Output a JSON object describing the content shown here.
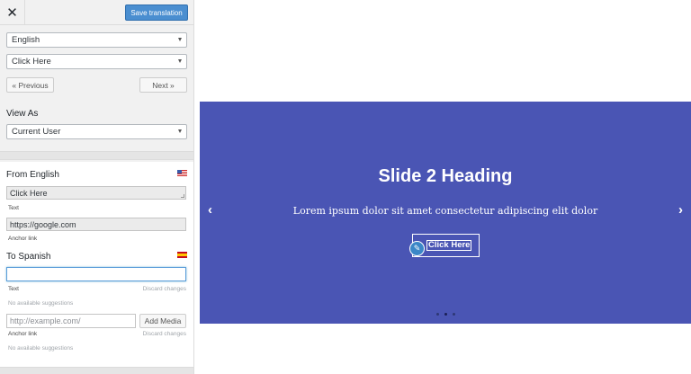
{
  "toolbar": {
    "save_label": "Save translation"
  },
  "language_select": {
    "value": "English"
  },
  "string_select": {
    "value": "Click Here"
  },
  "nav": {
    "previous": "« Previous",
    "next": "Next »"
  },
  "view_as": {
    "label": "View As",
    "value": "Current User"
  },
  "from": {
    "title": "From English",
    "text_value": "Click Here",
    "text_caption": "Text",
    "link_value": "https://google.com",
    "link_caption": "Anchor link"
  },
  "to": {
    "title": "To Spanish",
    "text_value": "",
    "text_caption": "Text",
    "discard": "Discard changes",
    "no_suggestions": "No available suggestions",
    "link_placeholder": "http://example.com/",
    "add_media": "Add Media",
    "link_caption": "Anchor link",
    "discard2": "Discard changes",
    "no_suggestions2": "No available suggestions"
  },
  "slide": {
    "heading": "Slide 2 Heading",
    "text": "Lorem ipsum dolor sit amet consectetur adipiscing elit dolor",
    "button": "Click Here",
    "prev_arrow": "‹",
    "next_arrow": "›",
    "total_slides": 3,
    "active_slide": 2
  },
  "colors": {
    "accent": "#4a8ed0",
    "slide_bg": "#4a55b4"
  }
}
